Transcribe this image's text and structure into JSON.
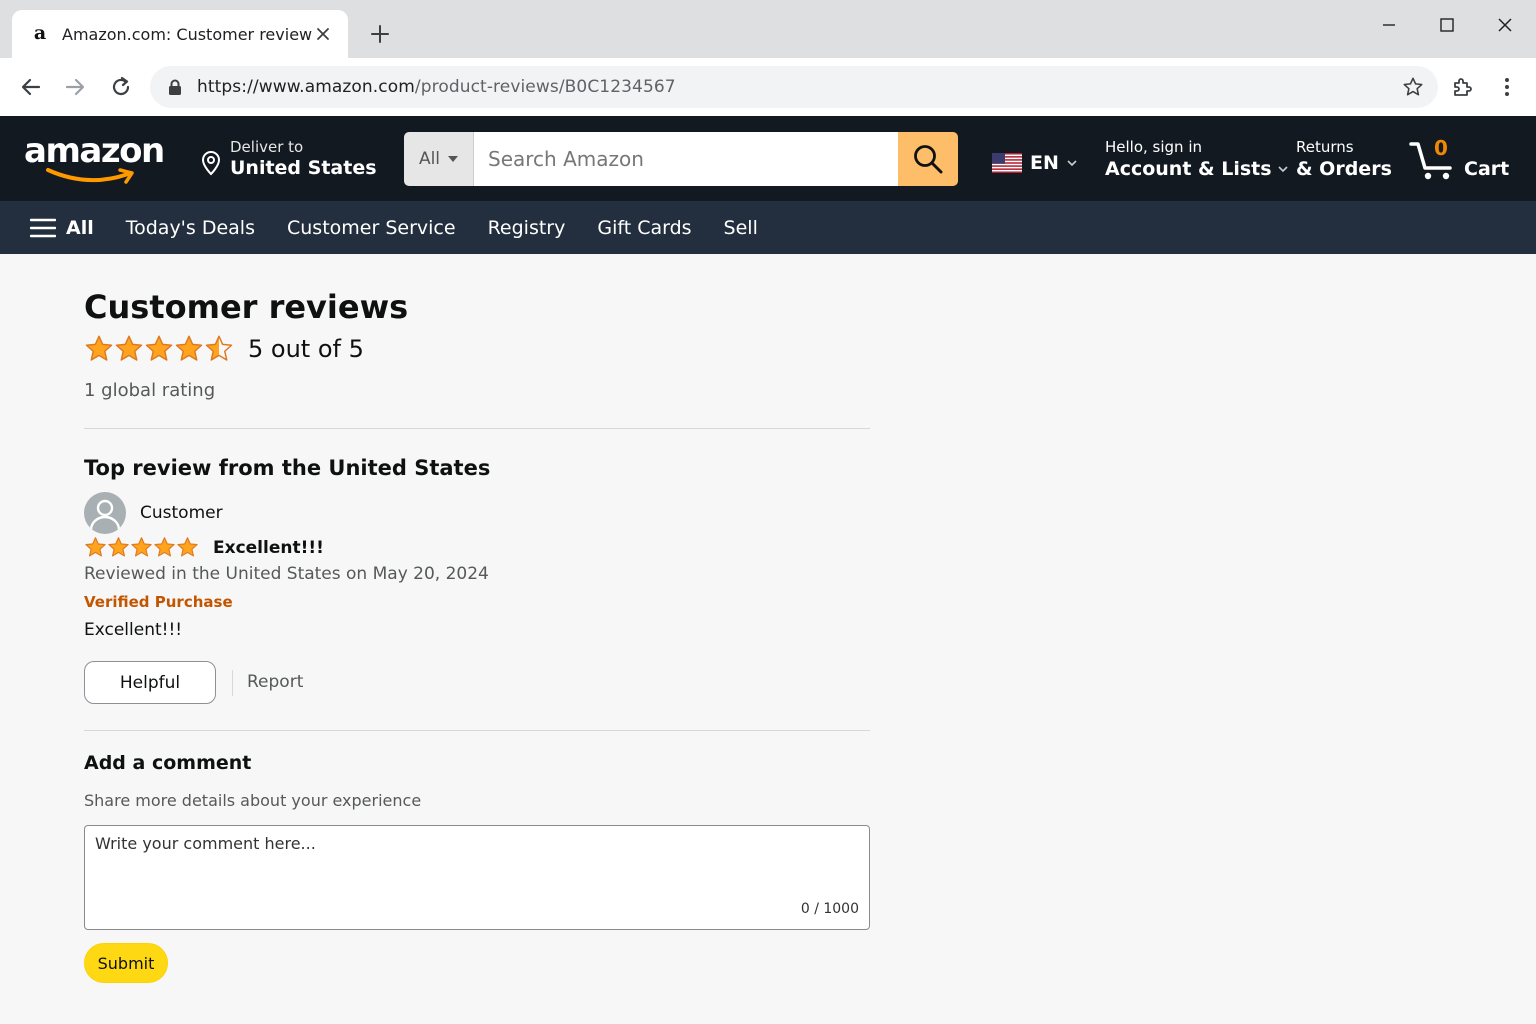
{
  "browser": {
    "tab_title": "Amazon.com: Customer reviews",
    "favicon_letter": "a",
    "url_host": "https://www.amazon.com",
    "url_path": "/product-reviews/B0C1234567"
  },
  "header": {
    "logo_text": "amazon",
    "deliver_line1": "Deliver to",
    "deliver_line2": "United States",
    "search_category": "All",
    "search_placeholder": "Search Amazon",
    "language": "EN",
    "account_line1": "Hello, sign in",
    "account_line2": "Account & Lists",
    "returns_line1": "Returns",
    "returns_line2": "& Orders",
    "cart_count": "0",
    "cart_label": "Cart",
    "accent_color": "#febd69",
    "header_bg": "#131921",
    "nav_bg": "#232f3e"
  },
  "nav": {
    "all_label": "All",
    "items": [
      "Today's Deals",
      "Customer Service",
      "Registry",
      "Gift Cards",
      "Sell"
    ]
  },
  "reviews": {
    "title": "Customer reviews",
    "rating_stars": 4.5,
    "rating_text": "5 out of 5",
    "global_rating": "1 global rating",
    "top_review_heading": "Top review from the United States",
    "review": {
      "reviewer": "Customer",
      "stars": 5,
      "title": "Excellent!!!",
      "date": "Reviewed in the United States on May 20, 2024",
      "verified": "Verified Purchase",
      "body": "Excellent!!!",
      "helpful_label": "Helpful",
      "report_label": "Report"
    }
  },
  "comment": {
    "title": "Add a comment",
    "subtitle": "Share more details about your experience",
    "placeholder": "Write your comment here...",
    "value": "",
    "char_count": "0 / 1000",
    "submit_label": "Submit"
  },
  "icons": {
    "star_color": "#ffa41c",
    "verified_color": "#c45500"
  }
}
